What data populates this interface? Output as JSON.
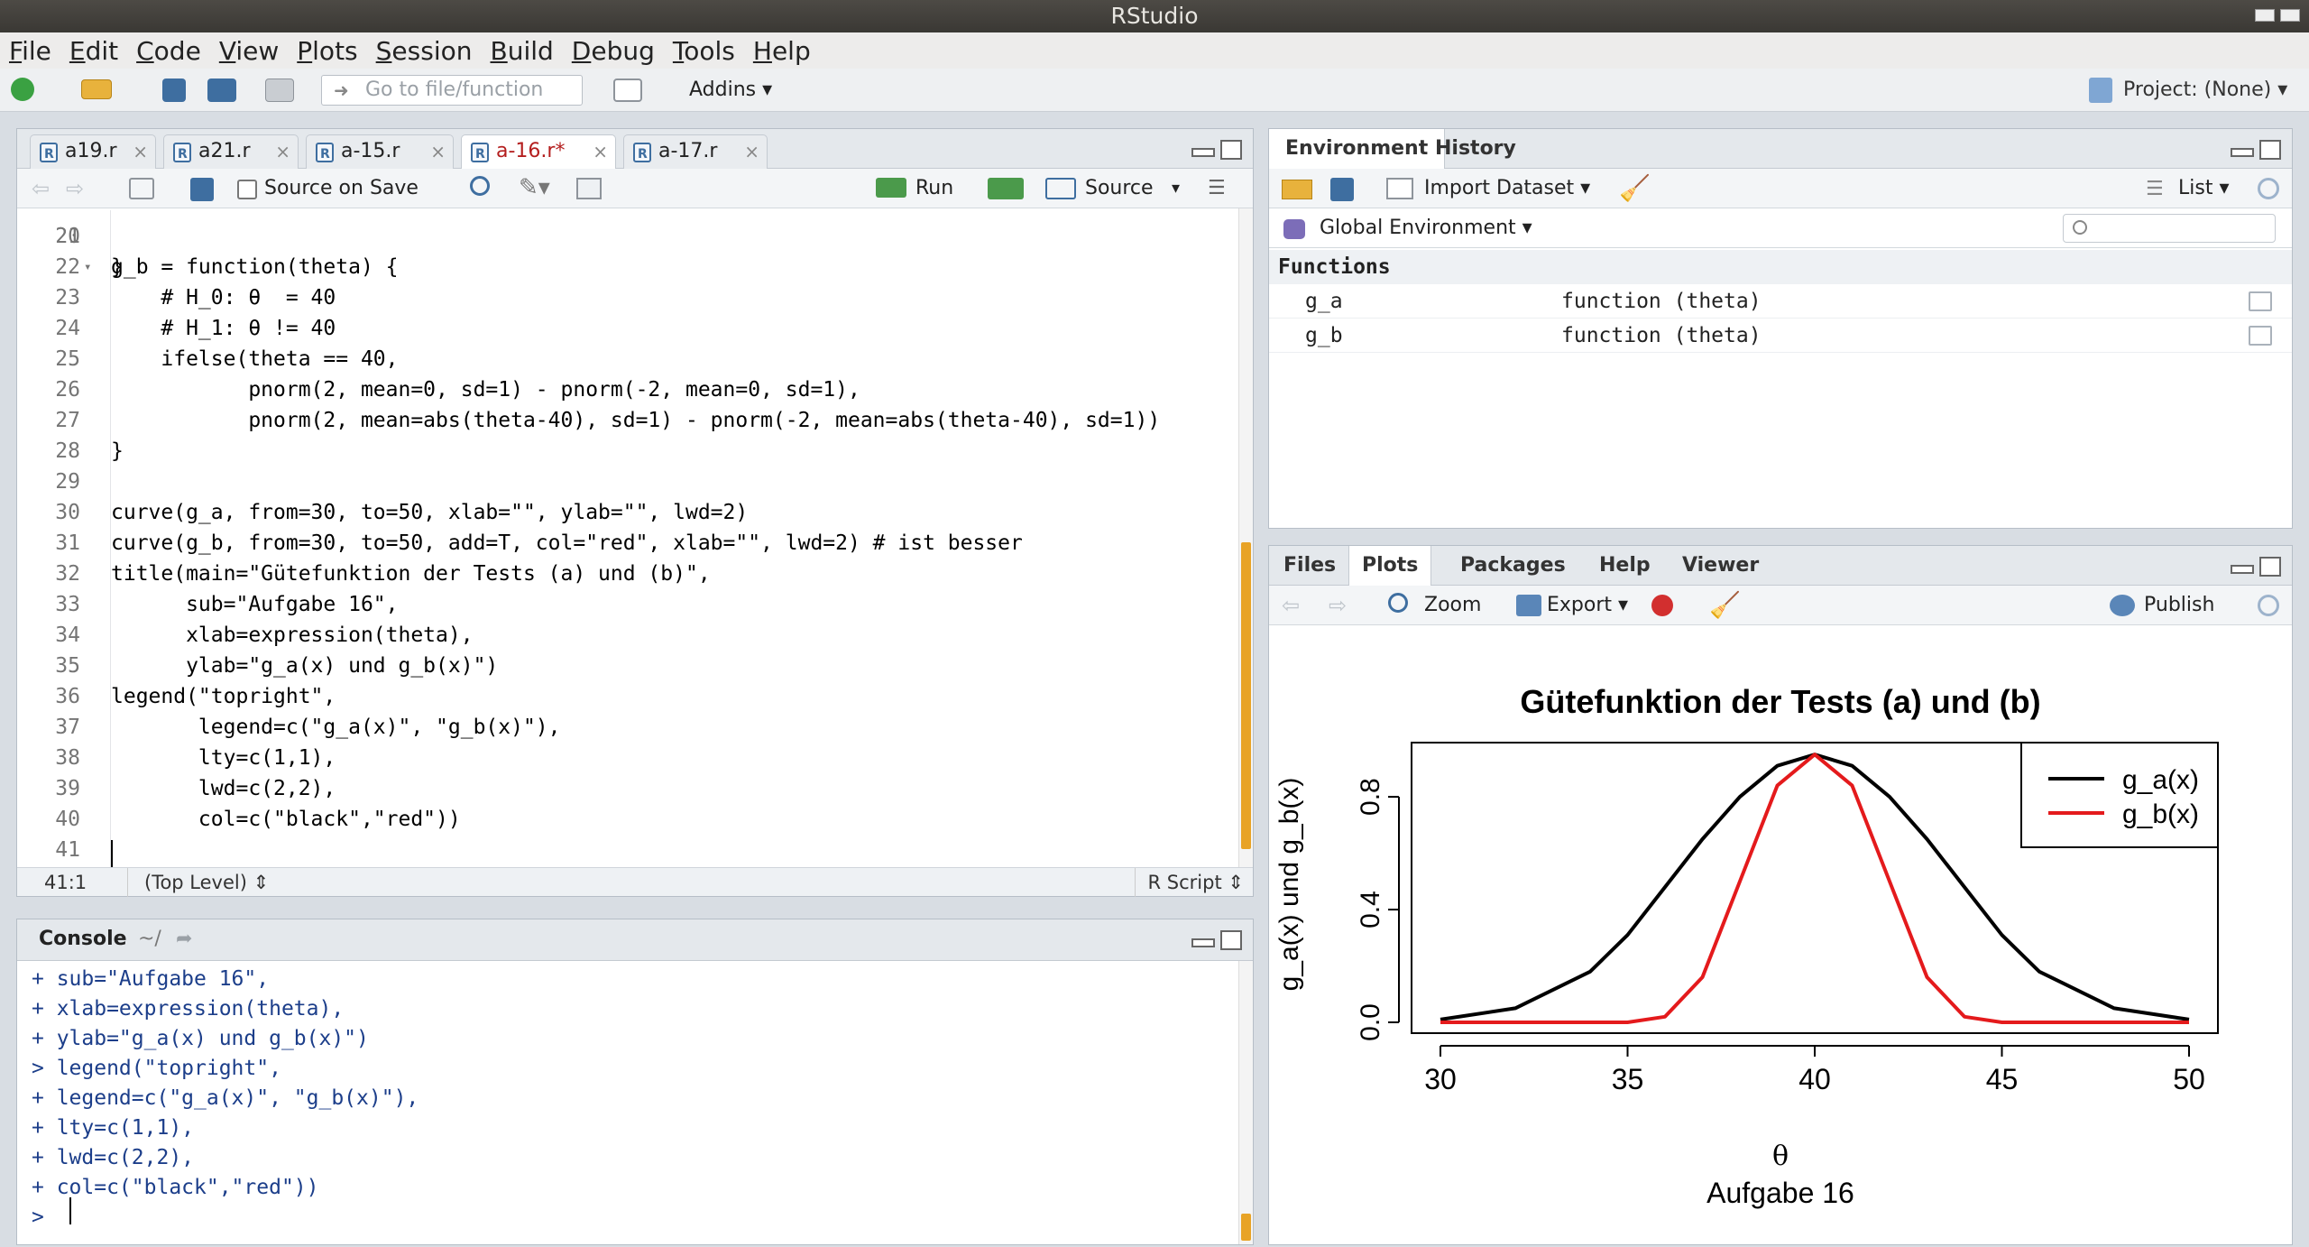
{
  "window": {
    "title": "RStudio"
  },
  "menubar": [
    "File",
    "Edit",
    "Code",
    "View",
    "Plots",
    "Session",
    "Build",
    "Debug",
    "Tools",
    "Help"
  ],
  "toolbar": {
    "goto_placeholder": "Go to file/function",
    "addins_label": "Addins",
    "project_label": "Project: (None)"
  },
  "editor": {
    "tabs": [
      {
        "label": "a19.r",
        "active": false
      },
      {
        "label": "a21.r",
        "active": false
      },
      {
        "label": "a-15.r",
        "active": false
      },
      {
        "label": "a-16.r*",
        "active": true
      },
      {
        "label": "a-17.r",
        "active": false
      }
    ],
    "toolbar": {
      "source_on_save": "Source on Save",
      "run": "Run",
      "source": "Source"
    },
    "partial_top_line": {
      "number": "20",
      "text": "}"
    },
    "lines": [
      {
        "n": "21",
        "text": ""
      },
      {
        "n": "22",
        "text": "g_b = function(theta) {"
      },
      {
        "n": "23",
        "text": "    # H_0: θ  = 40"
      },
      {
        "n": "24",
        "text": "    # H_1: θ != 40"
      },
      {
        "n": "25",
        "text": "    ifelse(theta == 40,"
      },
      {
        "n": "26",
        "text": "           pnorm(2, mean=0, sd=1) - pnorm(-2, mean=0, sd=1),"
      },
      {
        "n": "27",
        "text": "           pnorm(2, mean=abs(theta-40), sd=1) - pnorm(-2, mean=abs(theta-40), sd=1))"
      },
      {
        "n": "28",
        "text": "}"
      },
      {
        "n": "29",
        "text": ""
      },
      {
        "n": "30",
        "text": "curve(g_a, from=30, to=50, xlab=\"\", ylab=\"\", lwd=2)"
      },
      {
        "n": "31",
        "text": "curve(g_b, from=30, to=50, add=T, col=\"red\", xlab=\"\", lwd=2) # ist besser"
      },
      {
        "n": "32",
        "text": "title(main=\"Gütefunktion der Tests (a) und (b)\","
      },
      {
        "n": "33",
        "text": "      sub=\"Aufgabe 16\","
      },
      {
        "n": "34",
        "text": "      xlab=expression(theta),"
      },
      {
        "n": "35",
        "text": "      ylab=\"g_a(x) und g_b(x)\")"
      },
      {
        "n": "36",
        "text": "legend(\"topright\","
      },
      {
        "n": "37",
        "text": "       legend=c(\"g_a(x)\", \"g_b(x)\"),"
      },
      {
        "n": "38",
        "text": "       lty=c(1,1),"
      },
      {
        "n": "39",
        "text": "       lwd=c(2,2),"
      },
      {
        "n": "40",
        "text": "       col=c(\"black\",\"red\"))"
      },
      {
        "n": "41",
        "text": ""
      }
    ],
    "status": {
      "position": "41:1",
      "scope": "(Top Level)",
      "filetype": "R Script"
    }
  },
  "console": {
    "title": "Console",
    "path": "~/",
    "lines": [
      "+ sub=\"Aufgabe 16\",",
      "+ xlab=expression(theta),",
      "+ ylab=\"g_a(x) und g_b(x)\")",
      "> legend(\"topright\",",
      "+ legend=c(\"g_a(x)\", \"g_b(x)\"),",
      "+ lty=c(1,1),",
      "+ lwd=c(2,2),",
      "+ col=c(\"black\",\"red\"))",
      ">"
    ]
  },
  "environment": {
    "tabs": [
      "Environment",
      "History"
    ],
    "import_dataset": "Import Dataset",
    "view_mode": "List",
    "scope": "Global Environment",
    "section": "Functions",
    "rows": [
      {
        "name": "g_a",
        "value": "function (theta)"
      },
      {
        "name": "g_b",
        "value": "function (theta)"
      }
    ]
  },
  "files_pane": {
    "tabs": [
      "Files",
      "Plots",
      "Packages",
      "Help",
      "Viewer"
    ],
    "zoom": "Zoom",
    "export": "Export",
    "publish": "Publish"
  },
  "chart_data": {
    "type": "line",
    "title": "Gütefunktion der Tests (a) und (b)",
    "subtitle": "Aufgabe 16",
    "xlabel": "θ",
    "ylabel": "g_a(x) und g_b(x)",
    "xlim": [
      30,
      50
    ],
    "ylim": [
      0,
      0.954
    ],
    "xticks": [
      "30",
      "35",
      "40",
      "45",
      "50"
    ],
    "yticks": [
      "0.0",
      "0.4",
      "0.8"
    ],
    "legend": "top-right",
    "x": [
      30,
      32,
      34,
      35,
      36,
      37,
      38,
      39,
      40,
      41,
      42,
      43,
      44,
      45,
      46,
      48,
      50
    ],
    "series": [
      {
        "name": "g_a(x)",
        "color": "#000000",
        "values": [
          0.01,
          0.05,
          0.18,
          0.31,
          0.48,
          0.65,
          0.8,
          0.91,
          0.95,
          0.91,
          0.8,
          0.65,
          0.48,
          0.31,
          0.18,
          0.05,
          0.01
        ]
      },
      {
        "name": "g_b(x)",
        "color": "#e41a1c",
        "values": [
          0.0,
          0.0,
          0.0,
          0.0,
          0.02,
          0.16,
          0.5,
          0.84,
          0.95,
          0.84,
          0.5,
          0.16,
          0.02,
          0.0,
          0.0,
          0.0,
          0.0
        ]
      }
    ]
  }
}
